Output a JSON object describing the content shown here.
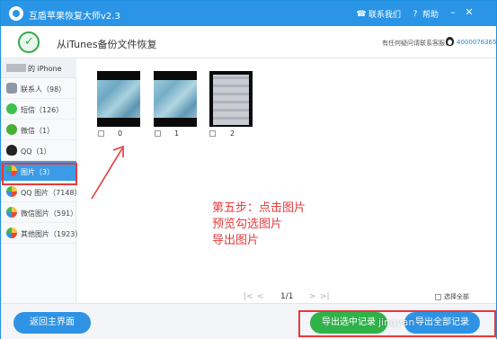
{
  "app": {
    "title": "互盾苹果恢复大师v2.3",
    "contact_label": "联系我们",
    "help_label": "帮助"
  },
  "header": {
    "mode_title": "从iTunes备份文件恢复",
    "contact_text": "有任何疑问请联系客服：",
    "contact_number": "4000076365"
  },
  "sidebar": {
    "device_name": "的 iPhone",
    "items": [
      {
        "label": "联系人（98）",
        "icon": "contacts-icon",
        "color": "#7a8aa0"
      },
      {
        "label": "短信（126）",
        "icon": "message-icon",
        "color": "#3ec04e"
      },
      {
        "label": "微信（1）",
        "icon": "wechat-icon",
        "color": "#46b035"
      },
      {
        "label": "QQ（1）",
        "icon": "qq-icon",
        "color": "#222222"
      },
      {
        "label": "图片（3）",
        "icon": "photos-icon",
        "color": "#f39c2a"
      },
      {
        "label": "QQ 图片（7148）",
        "icon": "qq-photos-icon",
        "color": "#f39c2a"
      },
      {
        "label": "微信图片（591）",
        "icon": "wechat-photos-icon",
        "color": "#f39c2a"
      },
      {
        "label": "其他图片（1923）",
        "icon": "other-photos-icon",
        "color": "#f39c2a"
      }
    ]
  },
  "thumbnails": [
    {
      "index": "0"
    },
    {
      "index": "1"
    },
    {
      "index": "2"
    }
  ],
  "annotation": {
    "line1": "第五步：点击图片",
    "line2": "预览勾选图片",
    "line3": "导出图片"
  },
  "pager": {
    "first": "|<",
    "prev": "<",
    "page": "1/1",
    "next": ">",
    "last": ">|",
    "select_all": "选择全部"
  },
  "footer": {
    "back_label": "返回主界面",
    "export_selected_label": "导出选中记录",
    "export_all_label": "导出全部记录",
    "watermark": "jingyan"
  },
  "colors": {
    "accent": "#2a95e6",
    "green": "#2fb24a",
    "highlight": "#e8383b"
  }
}
